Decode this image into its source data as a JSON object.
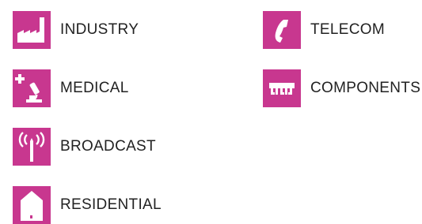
{
  "accent_color": "#c8378f",
  "categories": [
    {
      "label": "INDUSTRY",
      "icon": "factory-icon"
    },
    {
      "label": "MEDICAL",
      "icon": "microscope-icon"
    },
    {
      "label": "BROADCAST",
      "icon": "antenna-icon"
    },
    {
      "label": "RESIDENTIAL",
      "icon": "house-icon"
    },
    {
      "label": "TELECOM",
      "icon": "phone-icon"
    },
    {
      "label": "COMPONENTS",
      "icon": "chip-icon"
    }
  ]
}
